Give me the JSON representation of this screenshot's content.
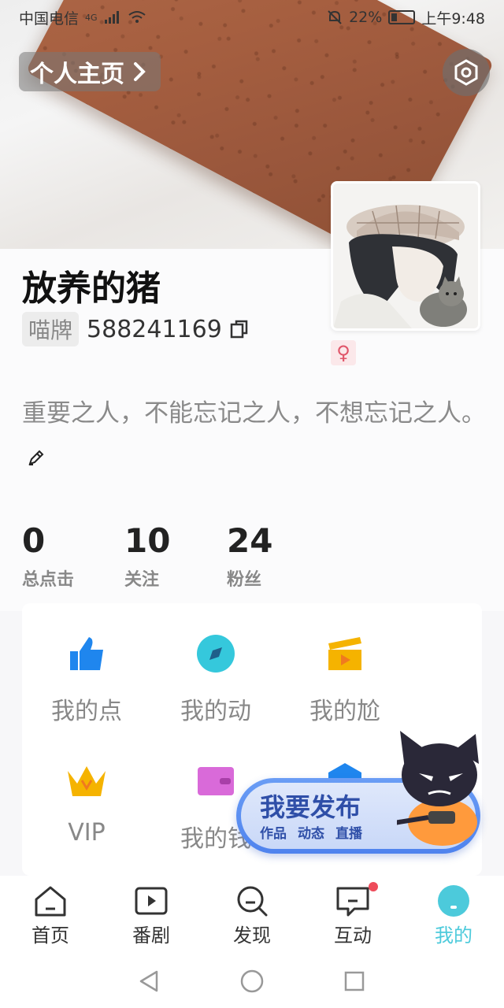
{
  "status_bar": {
    "carrier": "中国电信",
    "network": "4G",
    "battery_percent": "22%",
    "time": "上午9:48"
  },
  "header": {
    "profile_link_label": "个人主页",
    "settings_icon": "settings-hexagon-icon"
  },
  "profile": {
    "username": "放养的猪",
    "id_badge": "喵牌",
    "id_number": "588241169",
    "gender_symbol": "♀",
    "bio": "重要之人，不能忘记之人，不想忘记之人。"
  },
  "stats": [
    {
      "value": "0",
      "label": "总点击"
    },
    {
      "value": "10",
      "label": "关注"
    },
    {
      "value": "24",
      "label": "粉丝"
    }
  ],
  "grid": [
    {
      "label": "我的点",
      "icon": "thumbs-up-icon",
      "color": "#1f86ee"
    },
    {
      "label": "我的动",
      "icon": "compass-icon",
      "color": "#35c8dc"
    },
    {
      "label": "我的尬",
      "icon": "clapperboard-icon",
      "color": "#f5b300"
    },
    {
      "label": "VIP",
      "icon": "crown-icon",
      "color": "#f5b300"
    },
    {
      "label": "我的钱",
      "icon": "wallet-icon",
      "color": "#d96ad9"
    },
    {
      "label": "",
      "icon": "shield-icon",
      "color": "#1f86ee"
    }
  ],
  "publish": {
    "title": "我要发布",
    "options": [
      "作品",
      "动态",
      "直播"
    ]
  },
  "bottom_nav": [
    {
      "label": "首页",
      "icon": "home-icon"
    },
    {
      "label": "番剧",
      "icon": "play-icon"
    },
    {
      "label": "发现",
      "icon": "search-icon"
    },
    {
      "label": "互动",
      "icon": "message-icon",
      "badge": true
    },
    {
      "label": "我的",
      "icon": "me-icon",
      "active": true
    }
  ],
  "colors": {
    "accent": "#4ccadb",
    "badge": "#ee4b5a"
  }
}
